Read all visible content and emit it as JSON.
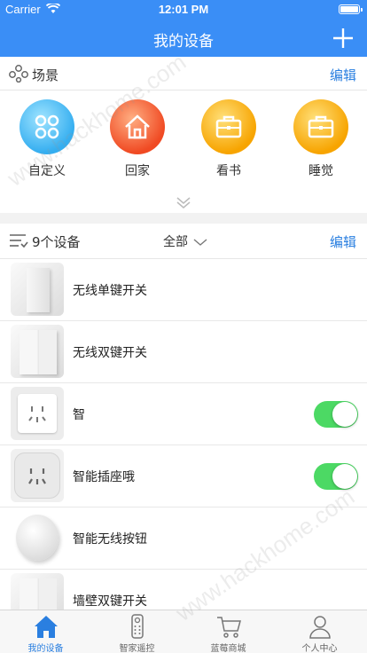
{
  "status_bar": {
    "carrier": "Carrier",
    "time": "12:01 PM"
  },
  "navbar": {
    "title": "我的设备",
    "add_icon": "plus-icon"
  },
  "scenes": {
    "title": "场景",
    "edit": "编辑",
    "items": [
      {
        "label": "自定义",
        "icon": "custom-scene-icon",
        "color": "#35aef0"
      },
      {
        "label": "回家",
        "icon": "home-icon",
        "color": "#f04a23"
      },
      {
        "label": "看书",
        "icon": "briefcase-icon",
        "color": "#f7a400"
      },
      {
        "label": "睡觉",
        "icon": "briefcase-icon",
        "color": "#f7a400"
      }
    ]
  },
  "devices": {
    "count_label": "9个设备",
    "filter": "全部",
    "edit": "编辑",
    "items": [
      {
        "name": "无线单键开关",
        "toggle": false
      },
      {
        "name": "无线双键开关",
        "toggle": false
      },
      {
        "name": "智",
        "toggle": true
      },
      {
        "name": "智能插座哦",
        "toggle": true
      },
      {
        "name": "智能无线按钮",
        "toggle": false
      },
      {
        "name": "墙壁双键开关",
        "toggle": false
      }
    ]
  },
  "tabbar": {
    "items": [
      {
        "label": "我的设备",
        "icon": "home-icon",
        "active": true
      },
      {
        "label": "智家遥控",
        "icon": "remote-icon",
        "active": false
      },
      {
        "label": "蓝莓商城",
        "icon": "cart-icon",
        "active": false
      },
      {
        "label": "个人中心",
        "icon": "user-icon",
        "active": false
      }
    ]
  },
  "watermark": "www.hackhome.com",
  "colors": {
    "accent": "#3a8ef6",
    "link": "#2a7fe0",
    "toggle_on": "#4cd964"
  }
}
